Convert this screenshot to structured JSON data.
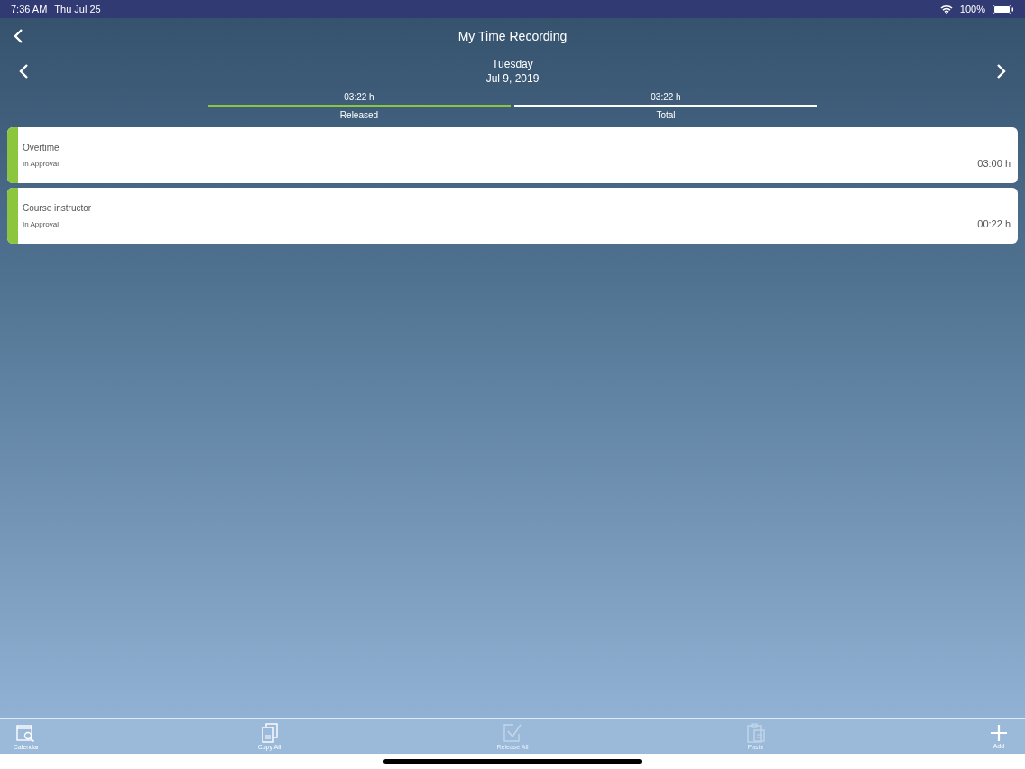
{
  "status_bar": {
    "time": "7:36 AM",
    "date": "Thu Jul 25",
    "battery": "100%"
  },
  "nav": {
    "title": "My Time Recording"
  },
  "day": {
    "weekday": "Tuesday",
    "date": "Jul 9, 2019"
  },
  "summary": [
    {
      "value": "03:22 h",
      "label": "Released",
      "color": "#8cc63f"
    },
    {
      "value": "03:22 h",
      "label": "Total",
      "color": "#ffffff"
    }
  ],
  "entries": [
    {
      "title": "Overtime",
      "status": "In Approval",
      "duration": "03:00 h",
      "color": "#8cc63f"
    },
    {
      "title": "Course instructor",
      "status": "In Approval",
      "duration": "00:22 h",
      "color": "#8cc63f"
    }
  ],
  "toolbar": [
    {
      "kind": "calendar",
      "label": "Calendar",
      "disabled": false
    },
    {
      "kind": "copy",
      "label": "Copy All",
      "disabled": false
    },
    {
      "kind": "release",
      "label": "Release All",
      "disabled": true
    },
    {
      "kind": "paste",
      "label": "Paste",
      "disabled": true
    },
    {
      "kind": "add",
      "label": "Add",
      "disabled": false
    }
  ]
}
